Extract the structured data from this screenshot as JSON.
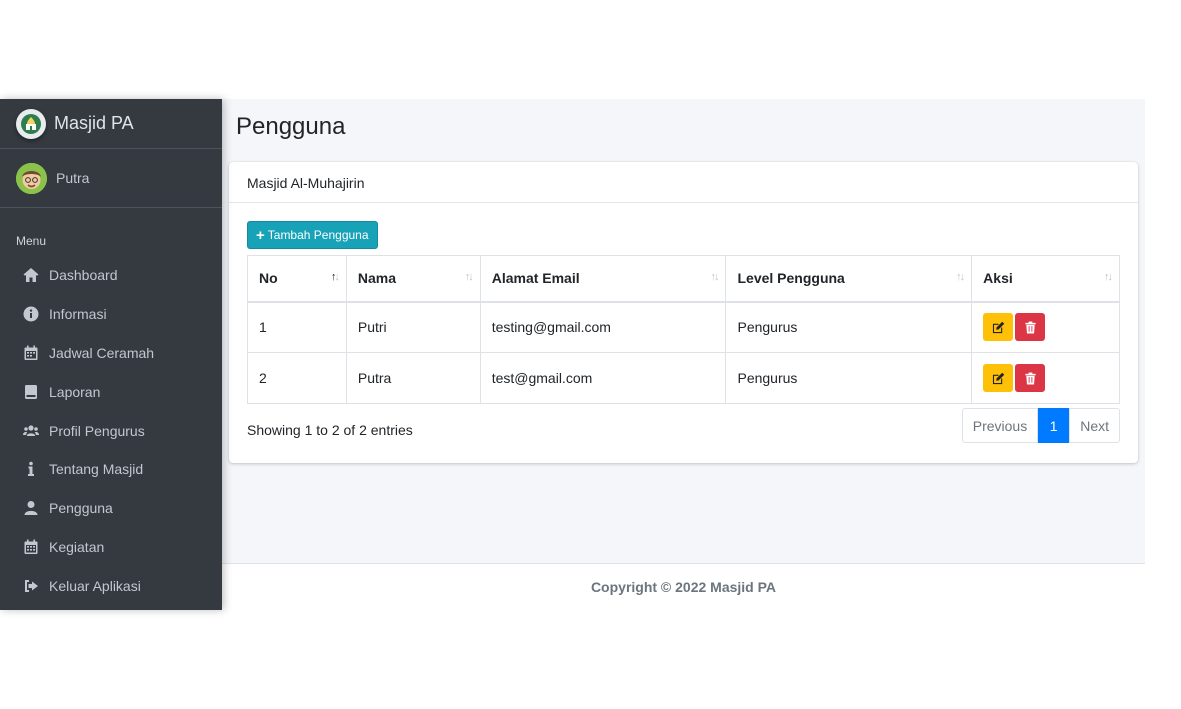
{
  "brand": {
    "name": "Masjid PA",
    "logo_icon": "mosque-logo-icon"
  },
  "user": {
    "name": "Putra",
    "avatar_icon": "user-avatar-icon"
  },
  "sidebar": {
    "header": "Menu",
    "items": [
      {
        "label": "Dashboard",
        "icon": "home-icon"
      },
      {
        "label": "Informasi",
        "icon": "info-circle-icon"
      },
      {
        "label": "Jadwal Ceramah",
        "icon": "calendar-icon"
      },
      {
        "label": "Laporan",
        "icon": "book-icon"
      },
      {
        "label": "Profil Pengurus",
        "icon": "users-icon"
      },
      {
        "label": "Tentang Masjid",
        "icon": "info-icon"
      },
      {
        "label": "Pengguna",
        "icon": "user-icon"
      },
      {
        "label": "Kegiatan",
        "icon": "calendar-alt-icon"
      },
      {
        "label": "Keluar Aplikasi",
        "icon": "sign-out-icon"
      }
    ]
  },
  "page": {
    "title": "Pengguna"
  },
  "card": {
    "header": "Masjid Al-Muhajirin",
    "add_button": "Tambah Pengguna"
  },
  "table": {
    "columns": [
      "No",
      "Nama",
      "Alamat Email",
      "Level Pengguna",
      "Aksi"
    ],
    "rows": [
      {
        "no": "1",
        "nama": "Putri",
        "email": "testing@gmail.com",
        "level": "Pengurus"
      },
      {
        "no": "2",
        "nama": "Putra",
        "email": "test@gmail.com",
        "level": "Pengurus"
      }
    ]
  },
  "info": "Showing 1 to 2 of 2 entries",
  "pagination": {
    "previous": "Previous",
    "current": "1",
    "next": "Next"
  },
  "footer": "Copyright © 2022 Masjid PA",
  "colors": {
    "sidebar": "#343a40",
    "accent": "#17a2b8",
    "primary": "#007bff",
    "warning": "#ffc107",
    "danger": "#dc3545"
  }
}
